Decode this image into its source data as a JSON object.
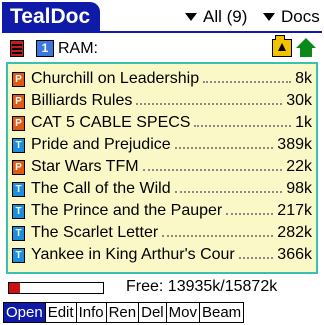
{
  "app": {
    "title": "TealDoc"
  },
  "header": {
    "filter_label": "All (9)",
    "view_label": "Docs"
  },
  "location": {
    "card_number": "1",
    "label": "RAM:"
  },
  "documents": [
    {
      "type": "P",
      "title": "Churchill on Leadership",
      "size": "8k"
    },
    {
      "type": "P",
      "title": "Billiards Rules",
      "size": "30k"
    },
    {
      "type": "P",
      "title": "CAT 5 CABLE SPECS",
      "size": "1k"
    },
    {
      "type": "T",
      "title": "Pride and Prejudice",
      "size": "389k"
    },
    {
      "type": "P",
      "title": "Star Wars TFM",
      "size": "22k"
    },
    {
      "type": "T",
      "title": "The Call of the Wild",
      "size": "98k"
    },
    {
      "type": "T",
      "title": "The Prince and the Pauper",
      "size": "217k"
    },
    {
      "type": "T",
      "title": "The Scarlet Letter",
      "size": "282k"
    },
    {
      "type": "T",
      "title": "Yankee in King Arthur's Cour",
      "size": "366k"
    }
  ],
  "memory": {
    "text": "Free: 13935k/15872k",
    "used_fraction": 0.12
  },
  "buttons": [
    "Open",
    "Edit",
    "Info",
    "Ren",
    "Del",
    "Mov",
    "Beam"
  ],
  "colors": {
    "accent": "#0f1aa8",
    "list_background": "#fbf8c8",
    "list_border": "#38c0b0",
    "p_badge": "#e05a10",
    "t_badge": "#1c8ee0",
    "memory_bar": "#d01010"
  },
  "icons": {
    "database": "database-icon",
    "card": "memory-card-icon",
    "up_folder": "up-folder-icon",
    "home": "home-icon"
  }
}
